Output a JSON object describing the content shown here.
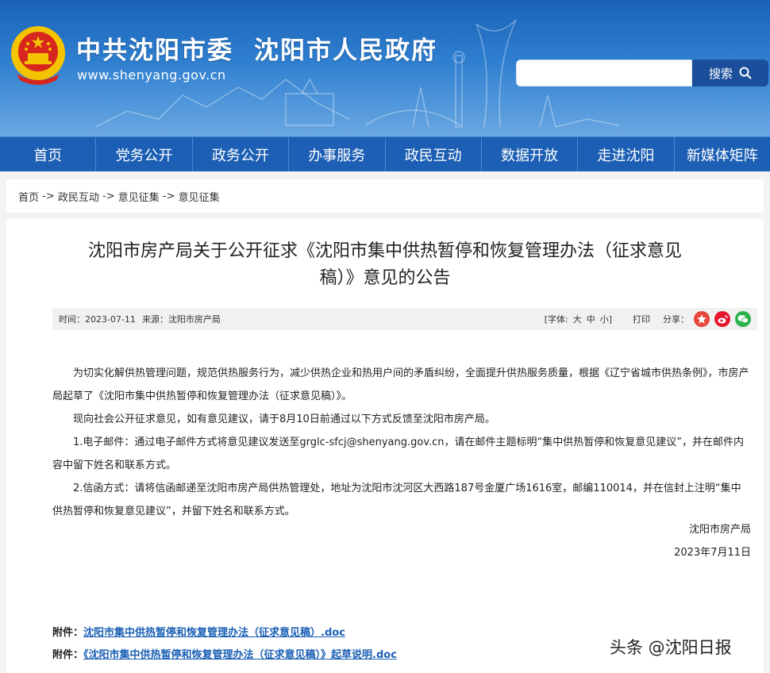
{
  "header": {
    "title_party": "中共沈阳市委",
    "title_gov": "沈阳市人民政府",
    "url": "www.shenyang.gov.cn",
    "search_button": "搜索",
    "search_value": ""
  },
  "nav": [
    "首页",
    "党务公开",
    "政务公开",
    "办事服务",
    "政民互动",
    "数据开放",
    "走进沈阳",
    "新媒体矩阵"
  ],
  "breadcrumb": [
    "首页",
    "政民互动",
    "意见征集",
    "意见征集"
  ],
  "breadcrumb_sep": " -> ",
  "article": {
    "title_line1": "沈阳市房产局关于公开征求《沈阳市集中供热暂停和恢复管理办法（征求意见",
    "title_line2": "稿）》意见的公告",
    "meta": {
      "time": "时间：2023-07-11",
      "source": "来源：沈阳市房产局",
      "font_label": "[字体:",
      "font_large": "大",
      "font_medium": "中",
      "font_small": "小]",
      "print": "打印",
      "share": "分享："
    },
    "paragraphs": [
      "为切实化解供热管理问题，规范供热服务行为，减少供热企业和热用户间的矛盾纠纷，全面提升供热服务质量，根据《辽宁省城市供热条例》，市房产局起草了《沈阳市集中供热暂停和恢复管理办法（征求意见稿）》。",
      "现向社会公开征求意见，如有意见建议，请于8月10日前通过以下方式反馈至沈阳市房产局。",
      "1.电子邮件：通过电子邮件方式将意见建议发送至grglc-sfcj@shenyang.gov.cn，请在邮件主题标明“集中供热暂停和恢复意见建议”，并在邮件内容中留下姓名和联系方式。",
      "2.信函方式：请将信函邮递至沈阳市房产局供热管理处，地址为沈阳市沈河区大西路187号金厦广场1616室，邮编110014，并在信封上注明“集中供热暂停和恢复意见建议”，并留下姓名和联系方式。"
    ],
    "signature": "沈阳市房产局",
    "date": "2023年7月11日",
    "attachments": [
      {
        "label": "附件：",
        "link": "沈阳市集中供热暂停和恢复管理办法（征求意见稿）.doc"
      },
      {
        "label": "附件：",
        "link": "《沈阳市集中供热暂停和恢复管理办法（征求意见稿）》起草说明.doc"
      }
    ]
  },
  "watermark": "头条 @沈阳日报",
  "colors": {
    "header_blue": "#1a63b8",
    "nav_blue": "#1c5fb4",
    "link_blue": "#1a5fb4",
    "emblem_red": "#d7261e",
    "emblem_gold": "#f4c400"
  }
}
